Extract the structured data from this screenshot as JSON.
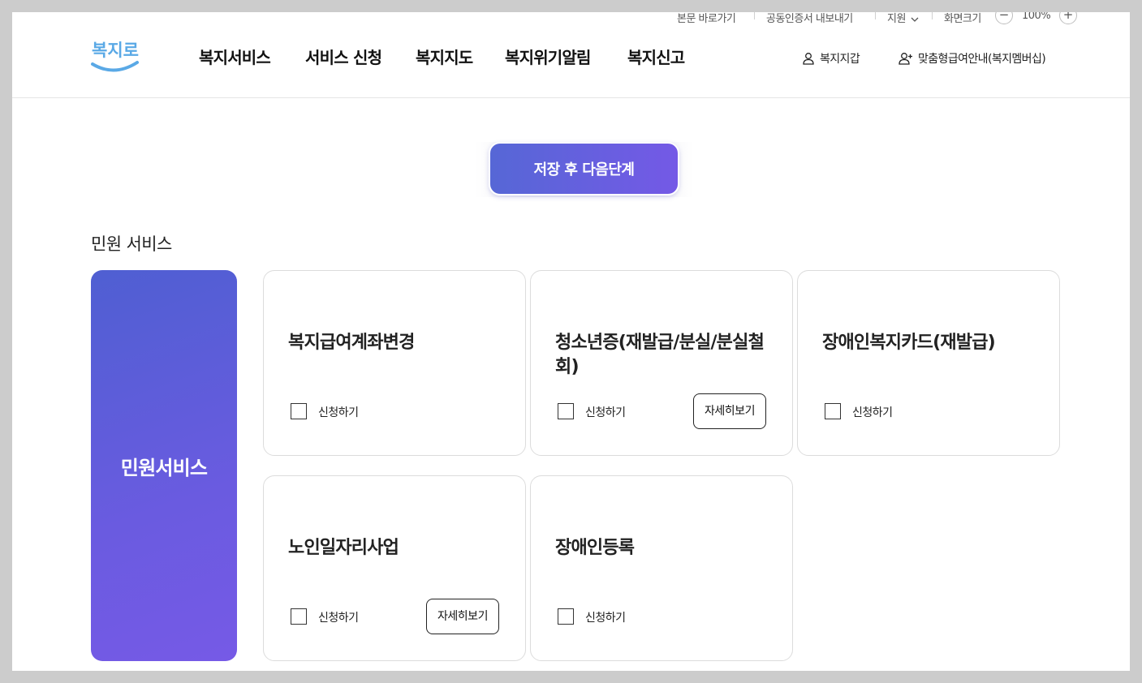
{
  "utility_bar": {
    "skip_to_content": "본문 바로가기",
    "export_certificate": "공동인증서 내보내기",
    "support": "지원",
    "screen_size_label": "화면크기",
    "zoom_minus": "−",
    "zoom_level": "100%",
    "zoom_plus": "+"
  },
  "header": {
    "logo_text": "복지로",
    "nav": [
      "복지서비스",
      "서비스 신청",
      "복지지도",
      "복지위기알림",
      "복지신고"
    ],
    "wallet_link": "복지지갑",
    "membership_link": "맞춤형급여안내(복지멤버십)"
  },
  "save_button": "저장 후 다음단계",
  "section_title": "민원 서비스",
  "side_card_label": "민원서비스",
  "cards": [
    {
      "title": "복지급여계좌변경",
      "apply": "신청하기",
      "detail": ""
    },
    {
      "title": "청소년증(재발급/분실/분실철회)",
      "apply": "신청하기",
      "detail": "자세히보기"
    },
    {
      "title": "장애인복지카드(재발급)",
      "apply": "신청하기",
      "detail": ""
    },
    {
      "title": "노인일자리사업",
      "apply": "신청하기",
      "detail": "자세히보기"
    },
    {
      "title": "장애인등록",
      "apply": "신청하기",
      "detail": ""
    }
  ],
  "colors": {
    "accent_start": "#5667d6",
    "accent_end": "#765ae6",
    "logo_blue": "#5aa9e6"
  },
  "icons": {
    "wallet": "user-icon",
    "membership": "user-plus-icon",
    "support_dropdown": "chevron-down-icon"
  }
}
